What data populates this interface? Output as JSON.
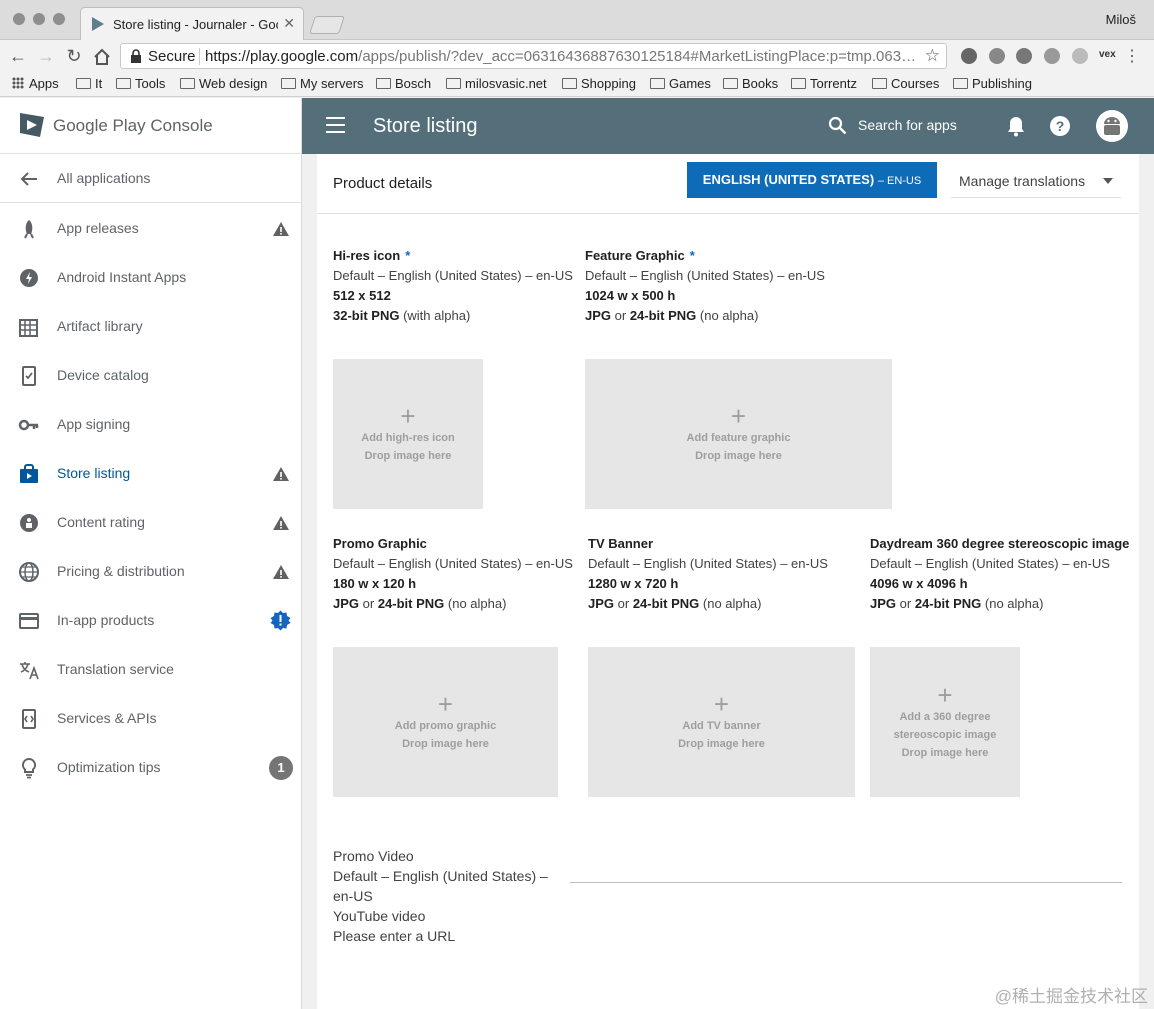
{
  "browser": {
    "tab_title": "Store listing - Journaler - Goo",
    "profile_name": "Miloš",
    "secure_label": "Secure",
    "url_host": "https://play.google.com",
    "url_path": "/apps/publish/?dev_acc=06316436887630125184#MarketListingPlace:p=tmp.063…",
    "ext_label": "vex",
    "bookmarks": [
      "Apps",
      "It",
      "Tools",
      "Web design",
      "My servers",
      "Bosch",
      "milosvasic.net",
      "Shopping",
      "Games",
      "Books",
      "Torrentz",
      "Courses",
      "Publishing"
    ]
  },
  "sidebar": {
    "logo_text": "Google Play Console",
    "back_label": "All applications",
    "items": [
      {
        "label": "App releases",
        "icon": "rocket-icon",
        "badge": "warning"
      },
      {
        "label": "Android Instant Apps",
        "icon": "lightning-icon",
        "badge": ""
      },
      {
        "label": "Artifact library",
        "icon": "grid-icon",
        "badge": ""
      },
      {
        "label": "Device catalog",
        "icon": "phone-icon",
        "badge": ""
      },
      {
        "label": "App signing",
        "icon": "key-icon",
        "badge": ""
      },
      {
        "label": "Store listing",
        "icon": "shopping-bag-icon",
        "badge": "warning",
        "active": true
      },
      {
        "label": "Content rating",
        "icon": "rating-icon",
        "badge": "warning"
      },
      {
        "label": "Pricing & distribution",
        "icon": "globe-icon",
        "badge": "warning"
      },
      {
        "label": "In-app products",
        "icon": "card-icon",
        "badge": "info"
      },
      {
        "label": "Translation service",
        "icon": "translate-icon",
        "badge": ""
      },
      {
        "label": "Services & APIs",
        "icon": "code-icon",
        "badge": ""
      },
      {
        "label": "Optimization tips",
        "icon": "lightbulb-icon",
        "badge": "1"
      }
    ]
  },
  "header": {
    "title": "Store listing",
    "search_label": "Search for apps"
  },
  "main": {
    "section_title": "Product details",
    "language_button": "ENGLISH (UNITED STATES)",
    "language_code": "– EN-US",
    "manage_translations": "Manage translations",
    "assets": {
      "hires": {
        "name": "Hi-res icon",
        "req": "*",
        "lang": "Default – English (United States) – en-US",
        "size": "512 x 512",
        "fmt1": "32-bit PNG",
        "fmt2": " (with alpha)",
        "drop1": "Add high-res icon",
        "drop2": "Drop image here"
      },
      "feature": {
        "name": "Feature Graphic",
        "req": "*",
        "lang": "Default – English (United States) – en-US",
        "size": "1024 w x 500 h",
        "fmt_a": "JPG",
        "fmt_or": " or ",
        "fmt_b": "24-bit PNG",
        "fmt_c": " (no alpha)",
        "drop1": "Add feature graphic",
        "drop2": "Drop image here"
      },
      "promo": {
        "name": "Promo Graphic",
        "lang": "Default – English (United States) – en-US",
        "size": "180 w x 120 h",
        "fmt_a": "JPG",
        "fmt_or": " or ",
        "fmt_b": "24-bit PNG",
        "fmt_c": " (no alpha)",
        "drop1": "Add promo graphic",
        "drop2": "Drop image here"
      },
      "tv": {
        "name": "TV Banner",
        "lang": "Default – English (United States) – en-US",
        "size": "1280 w x 720 h",
        "fmt_a": "JPG",
        "fmt_or": " or ",
        "fmt_b": "24-bit PNG",
        "fmt_c": " (no alpha)",
        "drop1": "Add TV banner",
        "drop2": "Drop image here"
      },
      "daydream": {
        "name": "Daydream 360 degree stereoscopic image",
        "lang": "Default – English (United States) – en-US",
        "size": "4096 w x 4096 h",
        "fmt_a": "JPG",
        "fmt_or": " or ",
        "fmt_b": "24-bit PNG",
        "fmt_c": " (no alpha)",
        "drop1": "Add a 360 degree",
        "drop1b": "stereoscopic image",
        "drop2": "Drop image here"
      }
    },
    "video": {
      "title": "Promo Video",
      "lang1": "Default – English (United States) –",
      "lang2": "en-US",
      "type": "YouTube video",
      "hint": "Please enter a URL"
    }
  },
  "watermark": "@稀土掘金技术社区",
  "colors": {
    "appbar": "#546e7a",
    "accent_blue": "#0d6bb8",
    "active_nav": "#01579b"
  }
}
